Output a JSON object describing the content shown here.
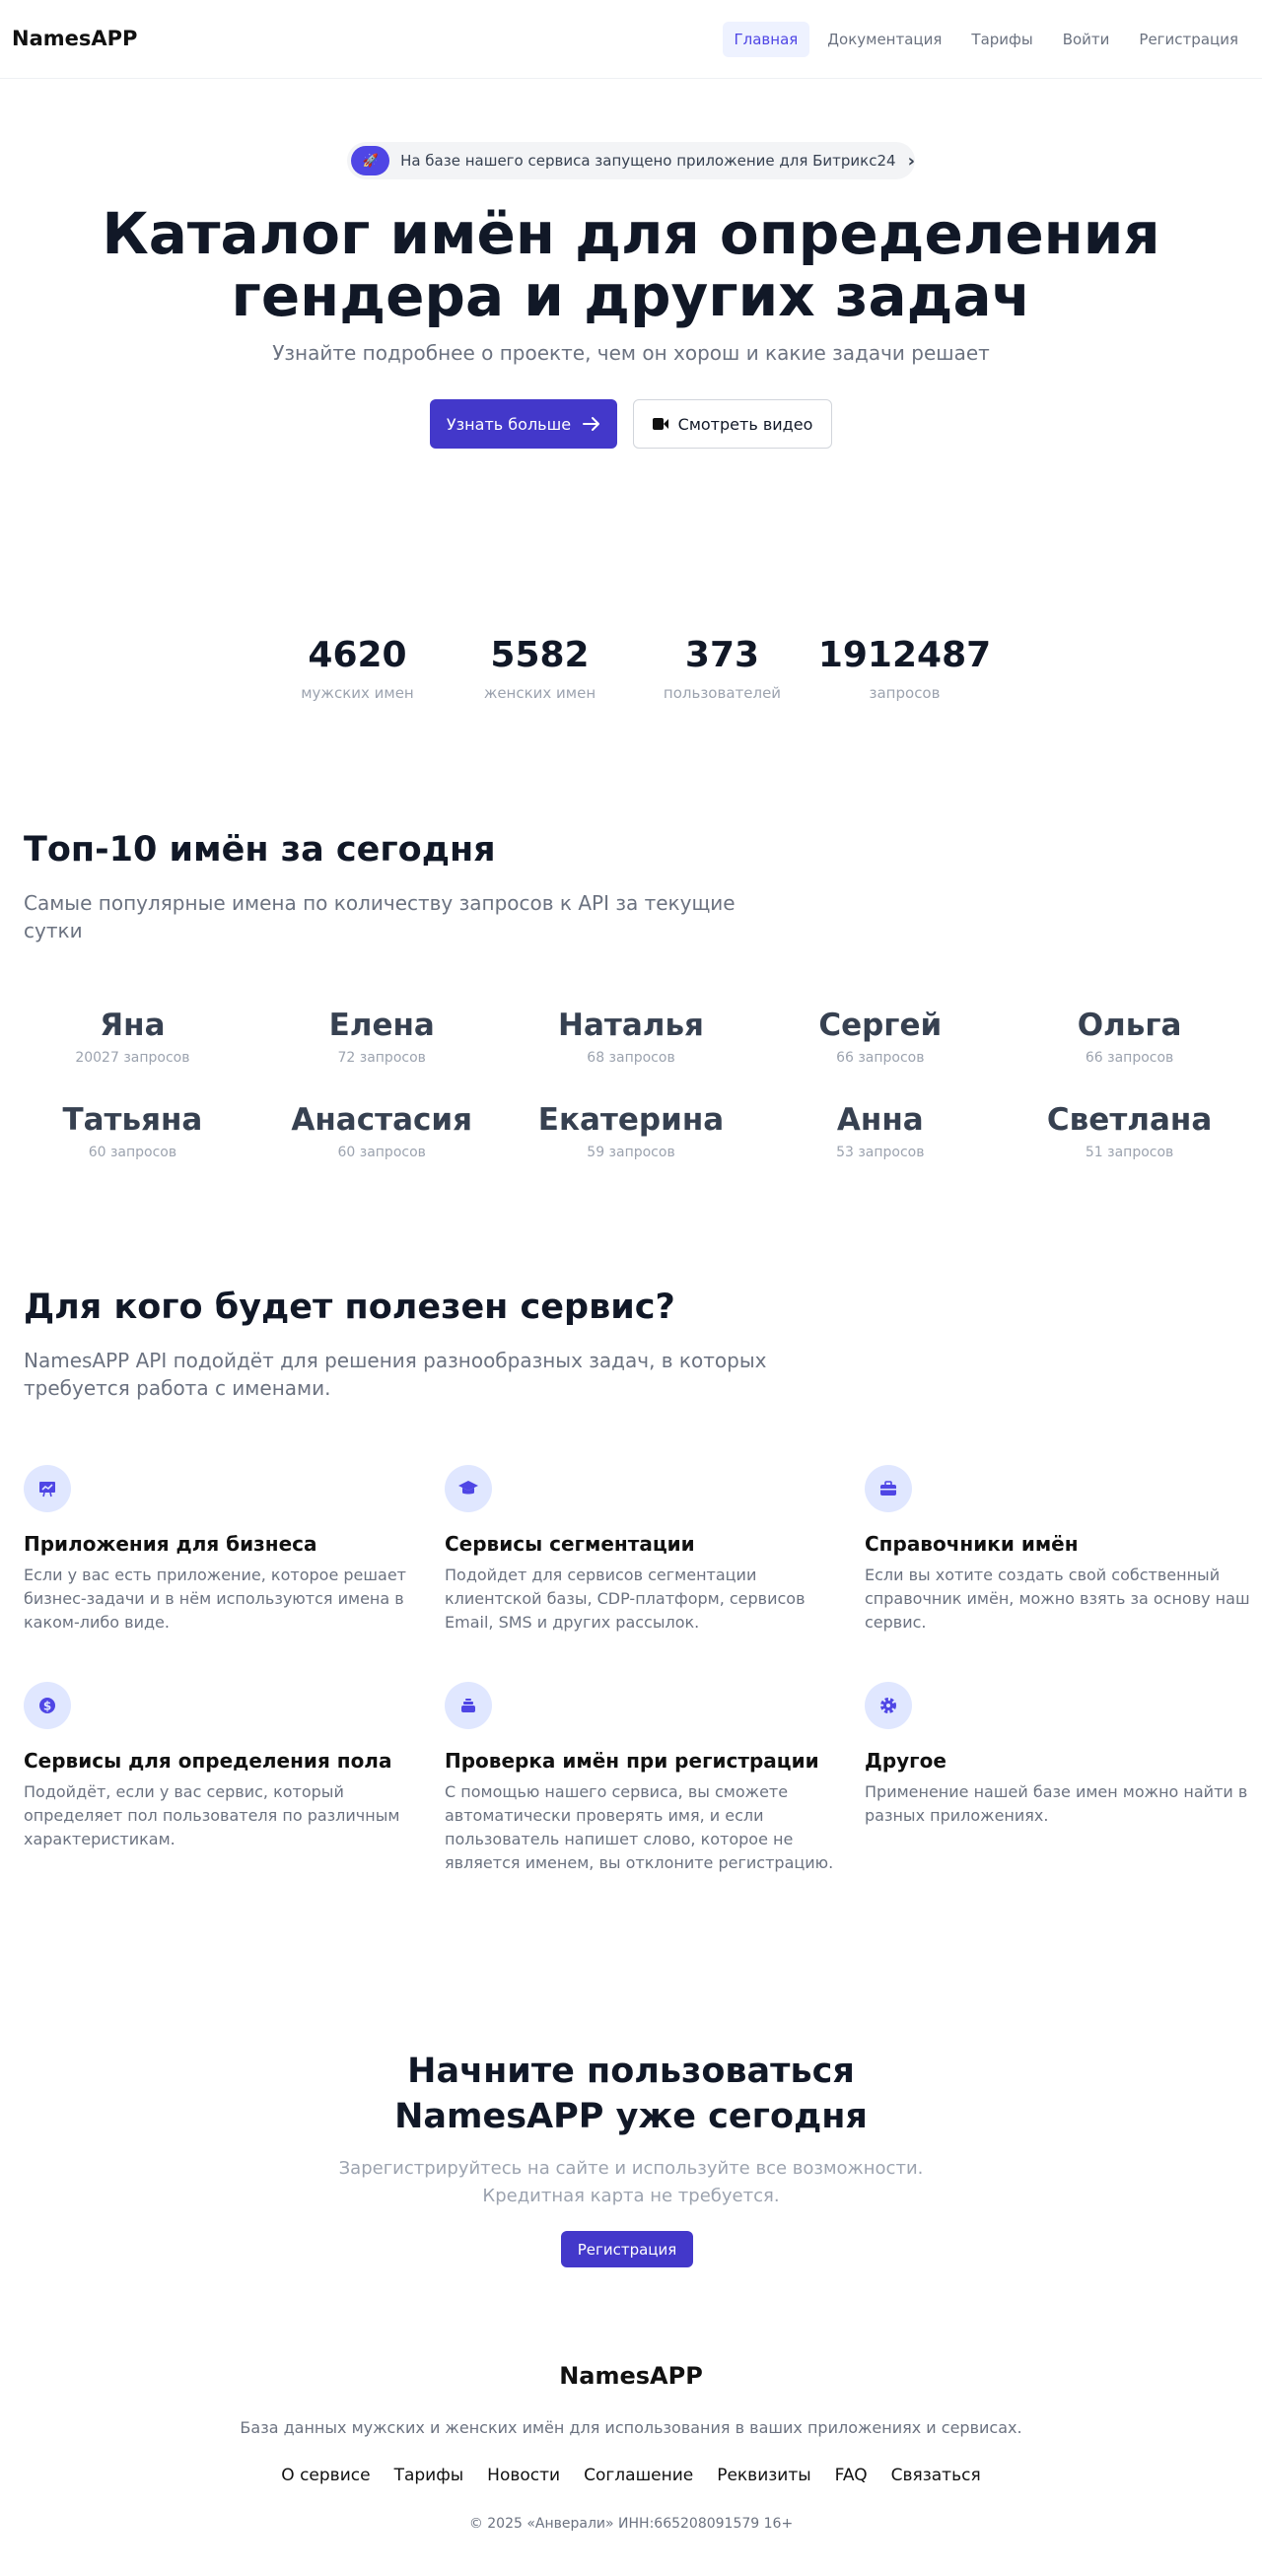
{
  "header": {
    "logo": "NamesAPP",
    "nav": [
      {
        "label": "Главная",
        "active": true
      },
      {
        "label": "Документация",
        "active": false
      },
      {
        "label": "Тарифы",
        "active": false
      },
      {
        "label": "Войти",
        "active": false
      },
      {
        "label": "Регистрация",
        "active": false
      }
    ]
  },
  "hero": {
    "announcement": {
      "badge_icon": "rocket-icon",
      "badge": "🚀",
      "text": "На базе нашего сервиса запущено приложение для Битрикс24",
      "arrow": "›"
    },
    "title_line1": "Каталог имён для определения",
    "title_line2": "гендера и других задач",
    "subtitle": "Узнайте подробнее о проекте, чем он хорош и какие задачи решает",
    "primary_button": "Узнать больше",
    "primary_button_icon": "arrow-right-icon",
    "secondary_button": "Смотреть видео",
    "secondary_button_icon": "video-icon"
  },
  "stats": [
    {
      "value": "4620",
      "label": "мужских имен"
    },
    {
      "value": "5582",
      "label": "женских имен"
    },
    {
      "value": "373",
      "label": "пользователей"
    },
    {
      "value": "1912487",
      "label": "запросов"
    }
  ],
  "top_names": {
    "title": "Топ-10 имён за сегодня",
    "subtitle": "Самые популярные имена по количеству запросов к API за текущие сутки",
    "items": [
      {
        "name": "Яна",
        "count": "20027 запросов"
      },
      {
        "name": "Елена",
        "count": "72 запросов"
      },
      {
        "name": "Наталья",
        "count": "68 запросов"
      },
      {
        "name": "Сергей",
        "count": "66 запросов"
      },
      {
        "name": "Ольга",
        "count": "66 запросов"
      },
      {
        "name": "Татьяна",
        "count": "60 запросов"
      },
      {
        "name": "Анастасия",
        "count": "60 запросов"
      },
      {
        "name": "Екатерина",
        "count": "59 запросов"
      },
      {
        "name": "Анна",
        "count": "53 запросов"
      },
      {
        "name": "Светлана",
        "count": "51 запросов"
      }
    ]
  },
  "features": {
    "title": "Для кого будет полезен сервис?",
    "subtitle": "NamesAPP API подойдёт для решения разнообразных задач, в которых требуется работа с именами.",
    "accent_color": "#4f46e5",
    "icon_bg_color": "#e0e7ff",
    "items": [
      {
        "icon": "presentation-chart-icon",
        "title": "Приложения для бизнеса",
        "text": "Если у вас есть приложение, которое решает бизнес-задачи и в нём используются имена в каком-либо виде."
      },
      {
        "icon": "academic-cap-icon",
        "title": "Сервисы сегментации",
        "text": "Подойдет для сервисов сегментации клиентской базы, CDP-платформ, сервисов Email, SMS и других рассылок."
      },
      {
        "icon": "briefcase-icon",
        "title": "Справочники имён",
        "text": "Если вы хотите создать свой собственный справочник имён, можно взять за основу наш сервис."
      },
      {
        "icon": "dollar-circle-icon",
        "title": "Сервисы для определения пола",
        "text": "Подойдёт, если у вас сервис, который определяет пол пользователя по различным характеристикам."
      },
      {
        "icon": "inbox-stack-icon",
        "title": "Проверка имён при регистрации",
        "text": "С помощью нашего сервиса, вы сможете автоматически проверять имя, и если пользователь напишет слово, которое не является именем, вы отклоните регистрацию."
      },
      {
        "icon": "gear-icon",
        "title": "Другое",
        "text": "Применение нашей базе имен можно найти в разных приложениях."
      }
    ]
  },
  "cta": {
    "title_line1": "Начните пользоваться",
    "title_line2": "NamesAPP уже сегодня",
    "sub_line1": "Зарегистрируйтесь на сайте и используйте все возможности.",
    "sub_line2": "Кредитная карта не требуется.",
    "button": "Регистрация"
  },
  "footer": {
    "logo": "NamesAPP",
    "description": "База данных мужских и женских имён для использования в ваших приложениях и сервисах.",
    "links": [
      "О сервисе",
      "Тарифы",
      "Новости",
      "Соглашение",
      "Реквизиты",
      "FAQ",
      "Связаться"
    ],
    "copyright": "© 2025 «Анверали» ИНН:665208091579 16+"
  }
}
